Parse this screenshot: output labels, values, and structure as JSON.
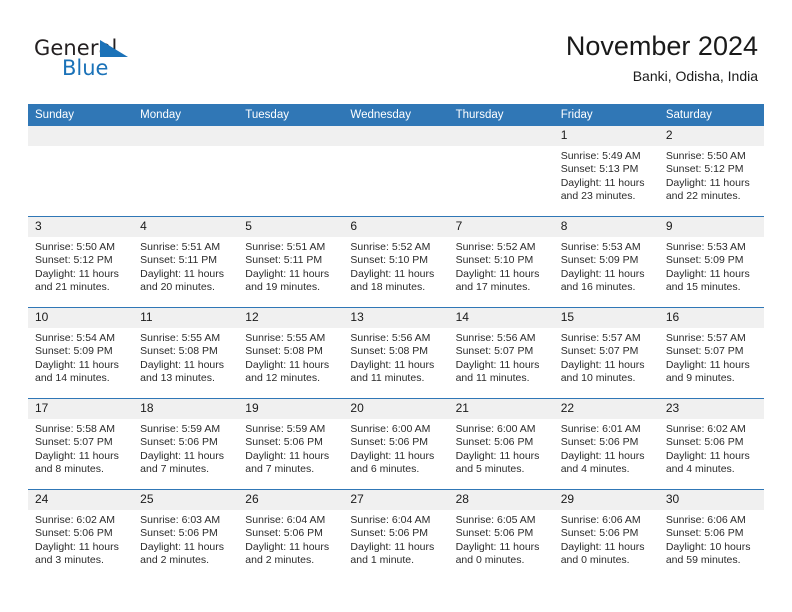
{
  "brand": {
    "name_part1": "General",
    "name_part2": "Blue",
    "triangle_color": "#1b72b8",
    "text_color": "#231f20"
  },
  "header": {
    "title": "November 2024",
    "subtitle": "Banki, Odisha, India"
  },
  "theme": {
    "header_blue": "#3077b6",
    "daynum_band": "#f0f0f0",
    "row_rule": "#3077b6"
  },
  "weekdays": [
    "Sunday",
    "Monday",
    "Tuesday",
    "Wednesday",
    "Thursday",
    "Friday",
    "Saturday"
  ],
  "labels": {
    "sunrise_prefix": "Sunrise:",
    "sunset_prefix": "Sunset:",
    "daylight_prefix": "Daylight:"
  },
  "weeks": [
    [
      {
        "day": "",
        "blank": true
      },
      {
        "day": "",
        "blank": true
      },
      {
        "day": "",
        "blank": true
      },
      {
        "day": "",
        "blank": true
      },
      {
        "day": "",
        "blank": true
      },
      {
        "day": "1",
        "sunrise": "Sunrise: 5:49 AM",
        "sunset": "Sunset: 5:13 PM",
        "daylight_line1": "Daylight: 11 hours",
        "daylight_line2": "and 23 minutes."
      },
      {
        "day": "2",
        "sunrise": "Sunrise: 5:50 AM",
        "sunset": "Sunset: 5:12 PM",
        "daylight_line1": "Daylight: 11 hours",
        "daylight_line2": "and 22 minutes."
      }
    ],
    [
      {
        "day": "3",
        "sunrise": "Sunrise: 5:50 AM",
        "sunset": "Sunset: 5:12 PM",
        "daylight_line1": "Daylight: 11 hours",
        "daylight_line2": "and 21 minutes."
      },
      {
        "day": "4",
        "sunrise": "Sunrise: 5:51 AM",
        "sunset": "Sunset: 5:11 PM",
        "daylight_line1": "Daylight: 11 hours",
        "daylight_line2": "and 20 minutes."
      },
      {
        "day": "5",
        "sunrise": "Sunrise: 5:51 AM",
        "sunset": "Sunset: 5:11 PM",
        "daylight_line1": "Daylight: 11 hours",
        "daylight_line2": "and 19 minutes."
      },
      {
        "day": "6",
        "sunrise": "Sunrise: 5:52 AM",
        "sunset": "Sunset: 5:10 PM",
        "daylight_line1": "Daylight: 11 hours",
        "daylight_line2": "and 18 minutes."
      },
      {
        "day": "7",
        "sunrise": "Sunrise: 5:52 AM",
        "sunset": "Sunset: 5:10 PM",
        "daylight_line1": "Daylight: 11 hours",
        "daylight_line2": "and 17 minutes."
      },
      {
        "day": "8",
        "sunrise": "Sunrise: 5:53 AM",
        "sunset": "Sunset: 5:09 PM",
        "daylight_line1": "Daylight: 11 hours",
        "daylight_line2": "and 16 minutes."
      },
      {
        "day": "9",
        "sunrise": "Sunrise: 5:53 AM",
        "sunset": "Sunset: 5:09 PM",
        "daylight_line1": "Daylight: 11 hours",
        "daylight_line2": "and 15 minutes."
      }
    ],
    [
      {
        "day": "10",
        "sunrise": "Sunrise: 5:54 AM",
        "sunset": "Sunset: 5:09 PM",
        "daylight_line1": "Daylight: 11 hours",
        "daylight_line2": "and 14 minutes."
      },
      {
        "day": "11",
        "sunrise": "Sunrise: 5:55 AM",
        "sunset": "Sunset: 5:08 PM",
        "daylight_line1": "Daylight: 11 hours",
        "daylight_line2": "and 13 minutes."
      },
      {
        "day": "12",
        "sunrise": "Sunrise: 5:55 AM",
        "sunset": "Sunset: 5:08 PM",
        "daylight_line1": "Daylight: 11 hours",
        "daylight_line2": "and 12 minutes."
      },
      {
        "day": "13",
        "sunrise": "Sunrise: 5:56 AM",
        "sunset": "Sunset: 5:08 PM",
        "daylight_line1": "Daylight: 11 hours",
        "daylight_line2": "and 11 minutes."
      },
      {
        "day": "14",
        "sunrise": "Sunrise: 5:56 AM",
        "sunset": "Sunset: 5:07 PM",
        "daylight_line1": "Daylight: 11 hours",
        "daylight_line2": "and 11 minutes."
      },
      {
        "day": "15",
        "sunrise": "Sunrise: 5:57 AM",
        "sunset": "Sunset: 5:07 PM",
        "daylight_line1": "Daylight: 11 hours",
        "daylight_line2": "and 10 minutes."
      },
      {
        "day": "16",
        "sunrise": "Sunrise: 5:57 AM",
        "sunset": "Sunset: 5:07 PM",
        "daylight_line1": "Daylight: 11 hours",
        "daylight_line2": "and 9 minutes."
      }
    ],
    [
      {
        "day": "17",
        "sunrise": "Sunrise: 5:58 AM",
        "sunset": "Sunset: 5:07 PM",
        "daylight_line1": "Daylight: 11 hours",
        "daylight_line2": "and 8 minutes."
      },
      {
        "day": "18",
        "sunrise": "Sunrise: 5:59 AM",
        "sunset": "Sunset: 5:06 PM",
        "daylight_line1": "Daylight: 11 hours",
        "daylight_line2": "and 7 minutes."
      },
      {
        "day": "19",
        "sunrise": "Sunrise: 5:59 AM",
        "sunset": "Sunset: 5:06 PM",
        "daylight_line1": "Daylight: 11 hours",
        "daylight_line2": "and 7 minutes."
      },
      {
        "day": "20",
        "sunrise": "Sunrise: 6:00 AM",
        "sunset": "Sunset: 5:06 PM",
        "daylight_line1": "Daylight: 11 hours",
        "daylight_line2": "and 6 minutes."
      },
      {
        "day": "21",
        "sunrise": "Sunrise: 6:00 AM",
        "sunset": "Sunset: 5:06 PM",
        "daylight_line1": "Daylight: 11 hours",
        "daylight_line2": "and 5 minutes."
      },
      {
        "day": "22",
        "sunrise": "Sunrise: 6:01 AM",
        "sunset": "Sunset: 5:06 PM",
        "daylight_line1": "Daylight: 11 hours",
        "daylight_line2": "and 4 minutes."
      },
      {
        "day": "23",
        "sunrise": "Sunrise: 6:02 AM",
        "sunset": "Sunset: 5:06 PM",
        "daylight_line1": "Daylight: 11 hours",
        "daylight_line2": "and 4 minutes."
      }
    ],
    [
      {
        "day": "24",
        "sunrise": "Sunrise: 6:02 AM",
        "sunset": "Sunset: 5:06 PM",
        "daylight_line1": "Daylight: 11 hours",
        "daylight_line2": "and 3 minutes."
      },
      {
        "day": "25",
        "sunrise": "Sunrise: 6:03 AM",
        "sunset": "Sunset: 5:06 PM",
        "daylight_line1": "Daylight: 11 hours",
        "daylight_line2": "and 2 minutes."
      },
      {
        "day": "26",
        "sunrise": "Sunrise: 6:04 AM",
        "sunset": "Sunset: 5:06 PM",
        "daylight_line1": "Daylight: 11 hours",
        "daylight_line2": "and 2 minutes."
      },
      {
        "day": "27",
        "sunrise": "Sunrise: 6:04 AM",
        "sunset": "Sunset: 5:06 PM",
        "daylight_line1": "Daylight: 11 hours",
        "daylight_line2": "and 1 minute."
      },
      {
        "day": "28",
        "sunrise": "Sunrise: 6:05 AM",
        "sunset": "Sunset: 5:06 PM",
        "daylight_line1": "Daylight: 11 hours",
        "daylight_line2": "and 0 minutes."
      },
      {
        "day": "29",
        "sunrise": "Sunrise: 6:06 AM",
        "sunset": "Sunset: 5:06 PM",
        "daylight_line1": "Daylight: 11 hours",
        "daylight_line2": "and 0 minutes."
      },
      {
        "day": "30",
        "sunrise": "Sunrise: 6:06 AM",
        "sunset": "Sunset: 5:06 PM",
        "daylight_line1": "Daylight: 10 hours",
        "daylight_line2": "and 59 minutes."
      }
    ]
  ]
}
